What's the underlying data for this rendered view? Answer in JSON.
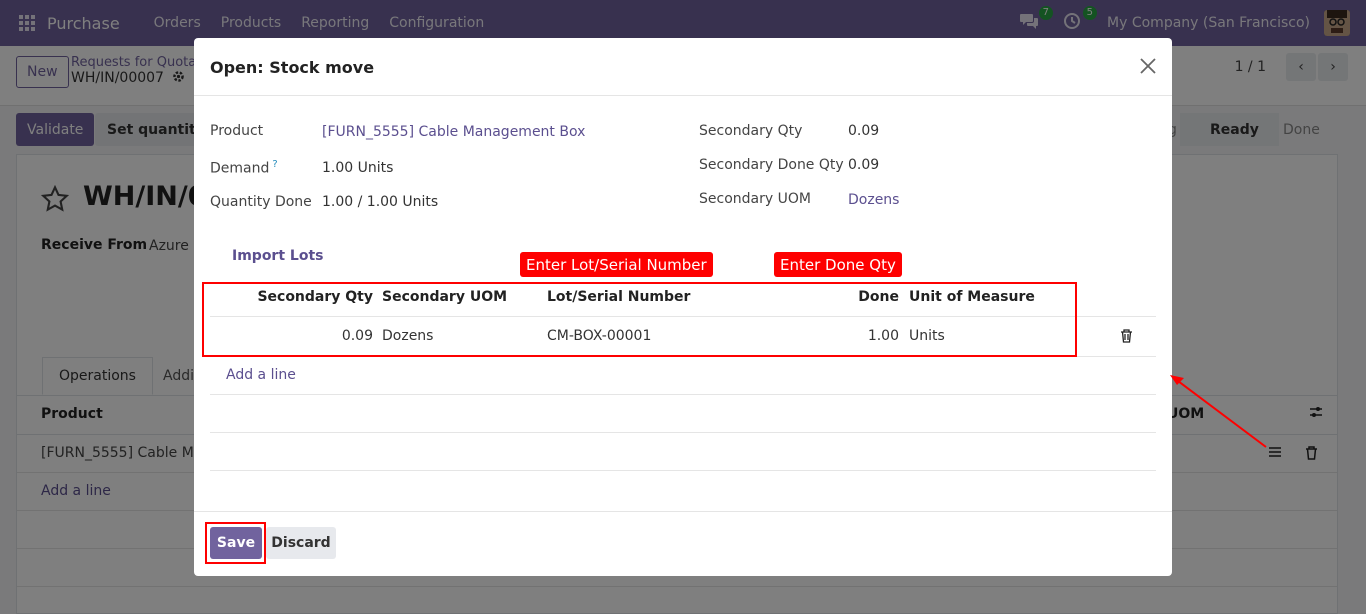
{
  "navbar": {
    "brand": "Purchase",
    "menu": [
      "Orders",
      "Products",
      "Reporting",
      "Configuration"
    ],
    "messages_count": "7",
    "activities_count": "5",
    "company": "My Company (San Francisco)"
  },
  "control_panel": {
    "new_label": "New",
    "breadcrumb_parent": "Requests for Quotat",
    "breadcrumb_current": "WH/IN/00007",
    "pager": "1 / 1"
  },
  "actions": {
    "validate_label": "Validate",
    "set_quantities_label": "Set quantities",
    "status_partial": "g",
    "status_ready": "Ready",
    "status_done": "Done"
  },
  "record": {
    "title": "WH/IN/0",
    "receive_from_label": "Receive From",
    "receive_from_value": "Azure I",
    "tabs": [
      "Operations",
      "Addi"
    ],
    "col_product": "Product",
    "col_uom_partial": "UOM",
    "row_product": "[FURN_5555] Cable Man",
    "add_line": "Add a line"
  },
  "modal": {
    "title": "Open: Stock move",
    "product_label": "Product",
    "product_value": "[FURN_5555] Cable Management Box",
    "demand_label": "Demand",
    "demand_help": "?",
    "demand_value": "1.00 Units",
    "qty_done_label": "Quantity Done",
    "qty_done_value": "1.00 / 1.00 Units",
    "sec_qty_label": "Secondary Qty",
    "sec_qty_value": "0.09",
    "sec_done_label": "Secondary Done Qty",
    "sec_done_value": "0.09",
    "sec_uom_label": "Secondary UOM",
    "sec_uom_value": "Dozens",
    "import_lots": "Import Lots",
    "note_lot": "Enter Lot/Serial Number",
    "note_done": "Enter Done Qty",
    "columns": {
      "sec_qty": "Secondary Qty",
      "sec_uom": "Secondary UOM",
      "lot": "Lot/Serial Number",
      "done": "Done",
      "uom": "Unit of Measure"
    },
    "row": {
      "sec_qty": "0.09",
      "sec_uom": "Dozens",
      "lot": "CM-BOX-00001",
      "done": "1.00",
      "uom": "Units"
    },
    "add_line": "Add a line",
    "save_label": "Save",
    "discard_label": "Discard"
  }
}
